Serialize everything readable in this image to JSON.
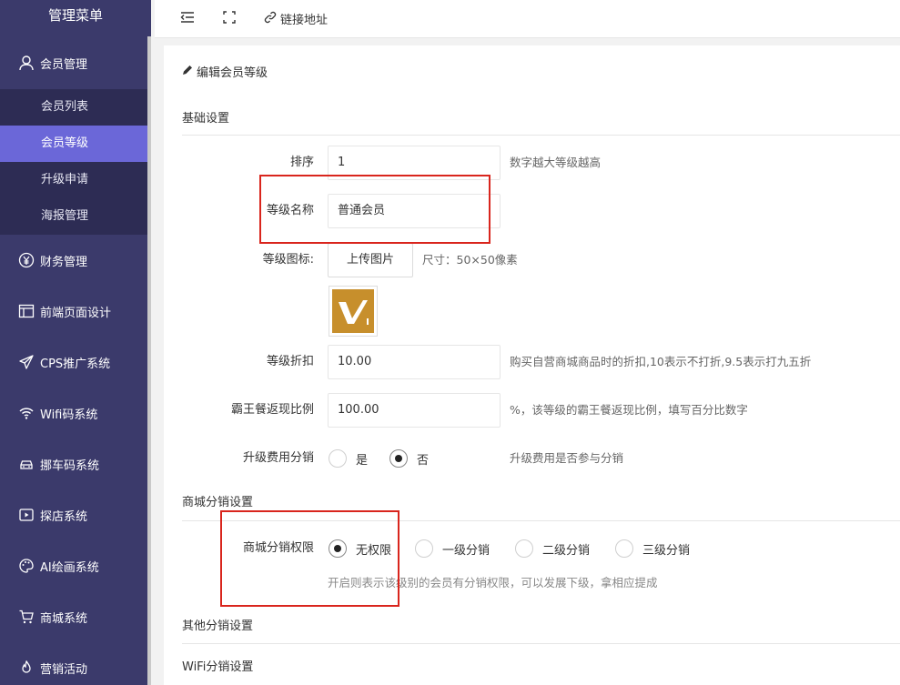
{
  "sidebar": {
    "title": "管理菜单",
    "member_group": {
      "label": "会员管理",
      "icon": "user-icon",
      "children": [
        {
          "label": "会员列表",
          "active": false
        },
        {
          "label": "会员等级",
          "active": true
        },
        {
          "label": "升级申请",
          "active": false
        },
        {
          "label": "海报管理",
          "active": false
        }
      ]
    },
    "items": [
      {
        "label": "财务管理",
        "icon": "yen-icon"
      },
      {
        "label": "前端页面设计",
        "icon": "layout-icon"
      },
      {
        "label": "CPS推广系统",
        "icon": "send-icon"
      },
      {
        "label": "Wifi码系统",
        "icon": "wifi-icon"
      },
      {
        "label": "挪车码系统",
        "icon": "car-icon"
      },
      {
        "label": "探店系统",
        "icon": "video-icon"
      },
      {
        "label": "AI绘画系统",
        "icon": "palette-icon"
      },
      {
        "label": "商城系统",
        "icon": "cart-icon"
      },
      {
        "label": "营销活动",
        "icon": "flame-icon"
      }
    ]
  },
  "topbar": {
    "link_label": "链接地址"
  },
  "page": {
    "title": "编辑会员等级",
    "sections": {
      "basic": "基础设置",
      "mall_dist": "商城分销设置",
      "other_dist": "其他分销设置",
      "wifi_dist": "WiFi分销设置"
    },
    "form": {
      "sort_label": "排序",
      "sort_value": "1",
      "sort_hint": "数字越大等级越高",
      "name_label": "等级名称",
      "name_value": "普通会员",
      "icon_label": "等级图标:",
      "upload_label": "上传图片",
      "icon_hint": "尺寸：50×50像素",
      "discount_label": "等级折扣",
      "discount_value": "10.00",
      "discount_hint": "购买自营商城商品时的折扣,10表示不打折,9.5表示打九五折",
      "cashback_label": "霸王餐返现比例",
      "cashback_value": "100.00",
      "cashback_hint": "%，该等级的霸王餐返现比例，填写百分比数字",
      "upgrade_label": "升级费用分销",
      "upgrade_options": [
        "是",
        "否"
      ],
      "upgrade_selected": "否",
      "upgrade_hint": "升级费用是否参与分销",
      "perm_label": "商城分销权限",
      "perm_options": [
        "无权限",
        "一级分销",
        "二级分销",
        "三级分销"
      ],
      "perm_selected": "无权限",
      "perm_hint": "开启则表示该级别的会员有分销权限，可以发展下级，拿相应提成"
    }
  },
  "colors": {
    "sidebar_bg": "#3b3a6b",
    "submenu_bg": "#2d2c54",
    "active_item": "#6b67d8",
    "highlight_red": "#d9251d",
    "level_icon_gold": "#c78f2c"
  }
}
